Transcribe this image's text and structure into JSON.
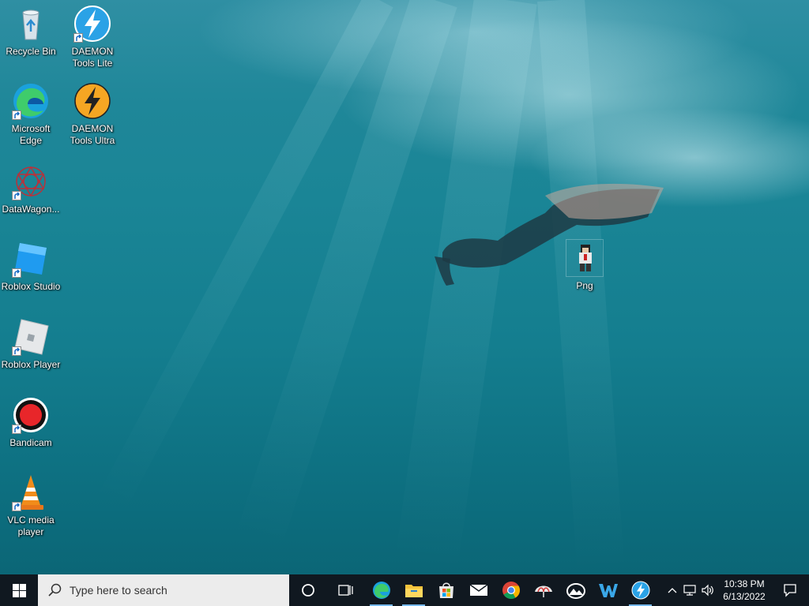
{
  "desktop": {
    "icons": [
      {
        "label": "Recycle Bin",
        "icon": "recycle-bin-icon"
      },
      {
        "label": "DAEMON Tools Lite",
        "icon": "daemon-tools-lite-icon"
      },
      {
        "label": "Microsoft Edge",
        "icon": "edge-icon"
      },
      {
        "label": "DAEMON Tools Ultra",
        "icon": "daemon-tools-ultra-icon"
      },
      {
        "label": "DataWagon...",
        "icon": "datawagon-icon"
      },
      {
        "label": "Roblox Studio",
        "icon": "roblox-studio-icon"
      },
      {
        "label": "Roblox Player",
        "icon": "roblox-player-icon"
      },
      {
        "label": "Bandicam",
        "icon": "bandicam-icon"
      },
      {
        "label": "VLC media player",
        "icon": "vlc-icon"
      },
      {
        "label": "Png",
        "icon": "png-file-icon"
      }
    ]
  },
  "taskbar": {
    "search_placeholder": "Type here to search",
    "pinned": [
      "edge-icon",
      "file-explorer-icon",
      "microsoft-store-icon",
      "mail-icon",
      "chrome-icon",
      "app-icon",
      "photos-icon",
      "app-w-icon",
      "daemon-tools-icon"
    ],
    "clock_time": "10:38 PM",
    "clock_date": "6/13/2022"
  },
  "colors": {
    "taskbar_bg": "#101820",
    "accent": "#76b9ed"
  }
}
